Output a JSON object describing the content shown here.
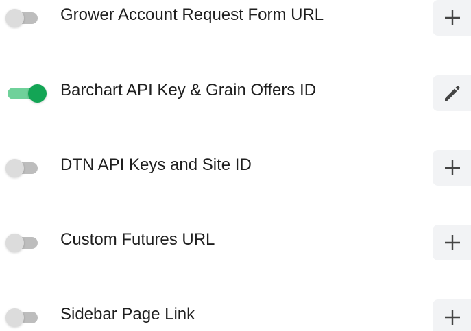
{
  "settings": [
    {
      "label": "Grower Account Request Form URL",
      "enabled": false,
      "action_icon": "plus-icon"
    },
    {
      "label": "Barchart API Key & Grain Offers ID",
      "enabled": true,
      "action_icon": "pencil-icon"
    },
    {
      "label": "DTN API Keys and Site ID",
      "enabled": false,
      "action_icon": "plus-icon"
    },
    {
      "label": "Custom Futures URL",
      "enabled": false,
      "action_icon": "plus-icon"
    },
    {
      "label": "Sidebar Page Link",
      "enabled": false,
      "action_icon": "plus-icon"
    }
  ],
  "colors": {
    "toggle_on_knob": "#13a555",
    "toggle_on_track": "#6fd19a",
    "toggle_off_knob": "#dcdcdc",
    "toggle_off_track": "#bdbdbd",
    "action_background": "#f2f3f5"
  }
}
